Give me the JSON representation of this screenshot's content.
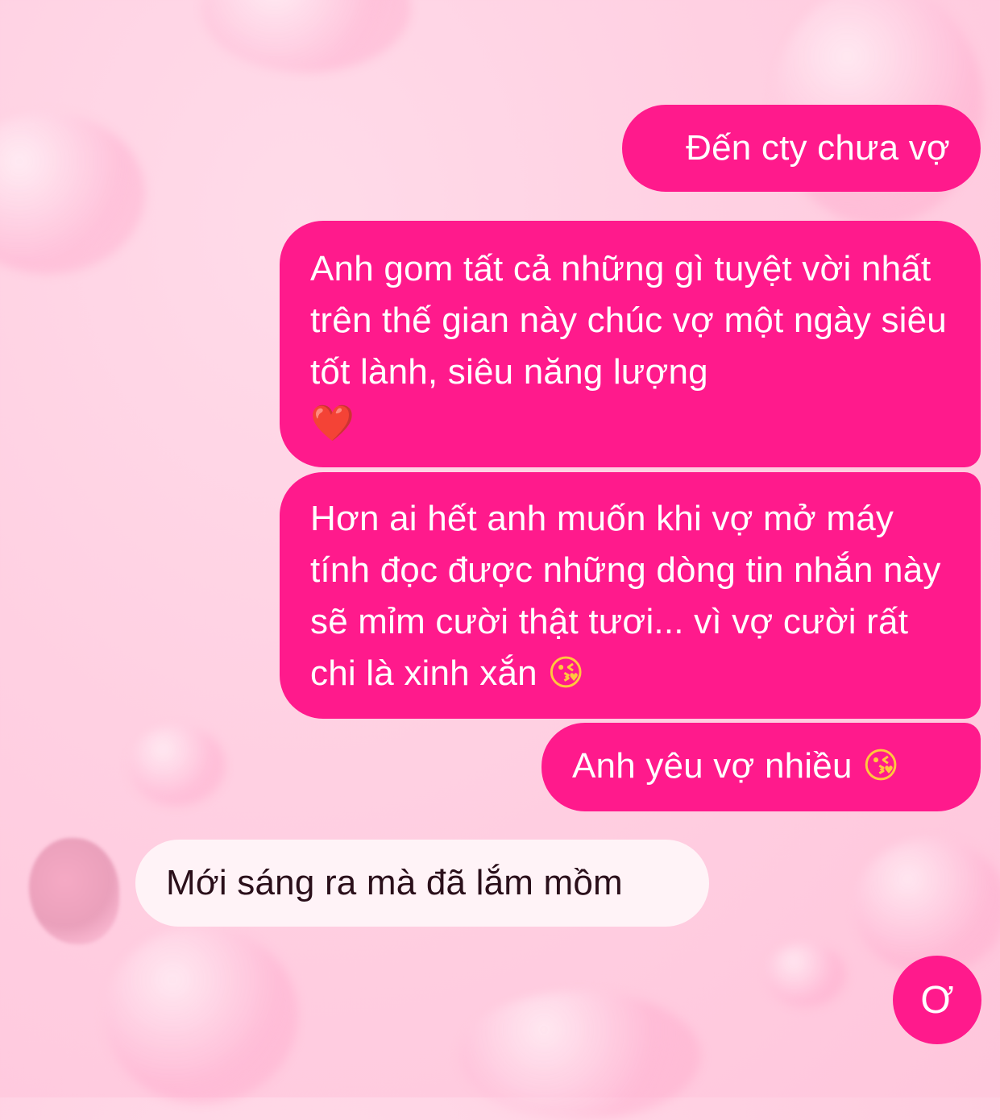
{
  "colors": {
    "outgoing_bubble": "#ff1a8c",
    "incoming_bubble": "#fff3f7",
    "background": "#ffd0e2"
  },
  "messages": [
    {
      "sender": "me",
      "text": "Đến cty chưa vợ"
    },
    {
      "sender": "me",
      "text": "Anh gom tất cả những gì tuyệt vời nhất trên thế gian này chúc vợ một ngày siêu tốt lành, siêu năng lượng",
      "emoji": "❤️",
      "emoji_icon": "red-heart-icon"
    },
    {
      "sender": "me",
      "text": "Hơn ai hết anh muốn khi vợ mở máy tính đọc được những dòng tin nhắn này sẽ mỉm cười thật tươi... vì vợ cười rất chi là xinh xắn",
      "emoji": "😘",
      "emoji_icon": "kissing-face-icon"
    },
    {
      "sender": "me",
      "text": "Anh yêu vợ nhiều",
      "emoji": "😘",
      "emoji_icon": "kissing-face-icon"
    },
    {
      "sender": "partner",
      "text": "Mới sáng ra mà đã lắm mồm"
    },
    {
      "sender": "me",
      "text": "Ơ"
    }
  ]
}
